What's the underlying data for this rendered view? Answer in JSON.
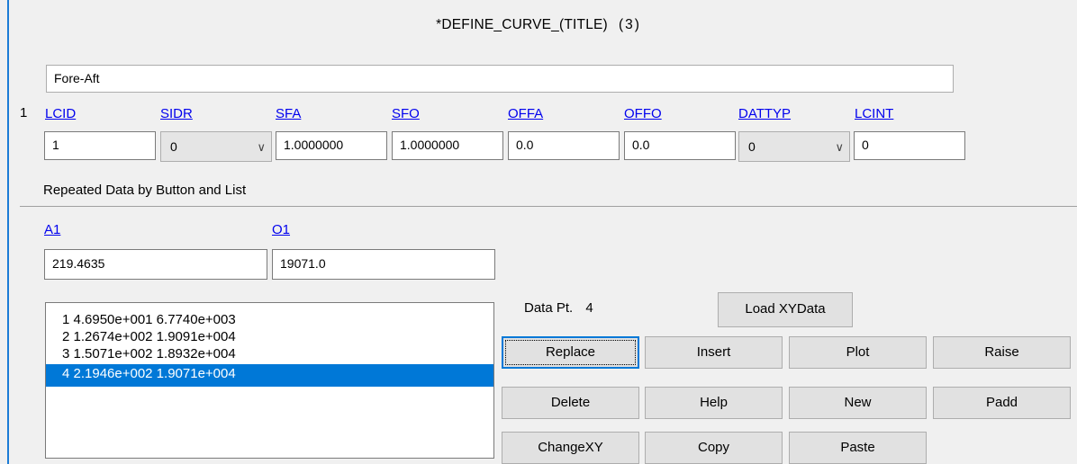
{
  "title": {
    "text": "*DEFINE_CURVE_(TITLE)",
    "count": "(3)"
  },
  "curve_title": "Fore-Aft",
  "card": {
    "row_number": "1",
    "headers": [
      "LCID",
      "SIDR",
      "SFA",
      "SFO",
      "OFFA",
      "OFFO",
      "DATTYP",
      "LCINT"
    ],
    "values": {
      "lcid": "1",
      "sidr": "0",
      "sfa": "1.0000000",
      "sfo": "1.0000000",
      "offa": "0.0",
      "offo": "0.0",
      "dattyp": "0",
      "lcint": "0"
    }
  },
  "repeated_section": {
    "label": "Repeated Data by Button and List",
    "a1_label": "A1",
    "o1_label": "O1",
    "a1_value": "219.4635",
    "o1_value": "19071.0"
  },
  "data_list": [
    "1 4.6950e+001 6.7740e+003",
    "2 1.2674e+002 1.9091e+004",
    "3 1.5071e+002 1.8932e+004",
    "4 2.1946e+002 1.9071e+004"
  ],
  "selected_index": 3,
  "data_point_label": "Data Pt.",
  "data_point_value": "4",
  "buttons": {
    "load_xydata": "Load XYData",
    "replace": "Replace",
    "insert": "Insert",
    "plot": "Plot",
    "raise": "Raise",
    "delete": "Delete",
    "help": "Help",
    "new": "New",
    "padd": "Padd",
    "changexy": "ChangeXY",
    "copy": "Copy",
    "paste": "Paste"
  },
  "colors": {
    "selection": "#0078d7",
    "link": "#0000ee",
    "focus": "#0078d7"
  }
}
